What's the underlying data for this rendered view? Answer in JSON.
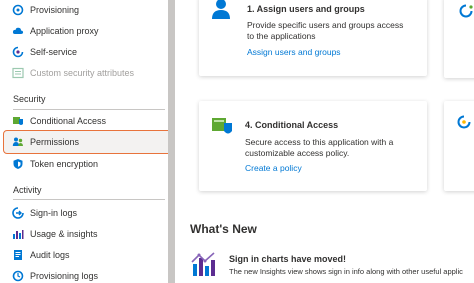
{
  "sidebar": {
    "items_top": [
      {
        "label": "Provisioning",
        "icon": "provisioning-icon"
      },
      {
        "label": "Application proxy",
        "icon": "cloud-icon"
      },
      {
        "label": "Self-service",
        "icon": "self-service-icon"
      },
      {
        "label": "Custom security attributes",
        "icon": "attributes-icon",
        "disabled": true
      }
    ],
    "security": {
      "heading": "Security",
      "items": [
        {
          "label": "Conditional Access",
          "icon": "conditional-access-icon"
        },
        {
          "label": "Permissions",
          "icon": "permissions-icon"
        },
        {
          "label": "Token encryption",
          "icon": "token-shield-icon"
        }
      ]
    },
    "activity": {
      "heading": "Activity",
      "items": [
        {
          "label": "Sign-in logs",
          "icon": "sign-in-logs-icon"
        },
        {
          "label": "Usage & insights",
          "icon": "insights-chart-icon"
        },
        {
          "label": "Audit logs",
          "icon": "audit-logs-icon"
        },
        {
          "label": "Provisioning logs",
          "icon": "provisioning-logs-icon"
        }
      ]
    }
  },
  "cards": {
    "assign": {
      "title": "1. Assign users and groups",
      "desc_line1": "Provide specific users and groups access",
      "desc_line2": "to the applications",
      "link": "Assign users and groups"
    },
    "conditional": {
      "title": "4. Conditional Access",
      "desc_line1": "Secure access to this application with a",
      "desc_line2": "customizable access policy.",
      "link": "Create a policy"
    }
  },
  "whats_new": {
    "heading": "What's New",
    "item_title": "Sign in charts have moved!",
    "item_desc": "The new Insights view shows sign in info along with other useful applic"
  },
  "colors": {
    "accent": "#0078d4",
    "highlight_border": "#e8733c",
    "selected_bg": "#f3f2f1"
  }
}
